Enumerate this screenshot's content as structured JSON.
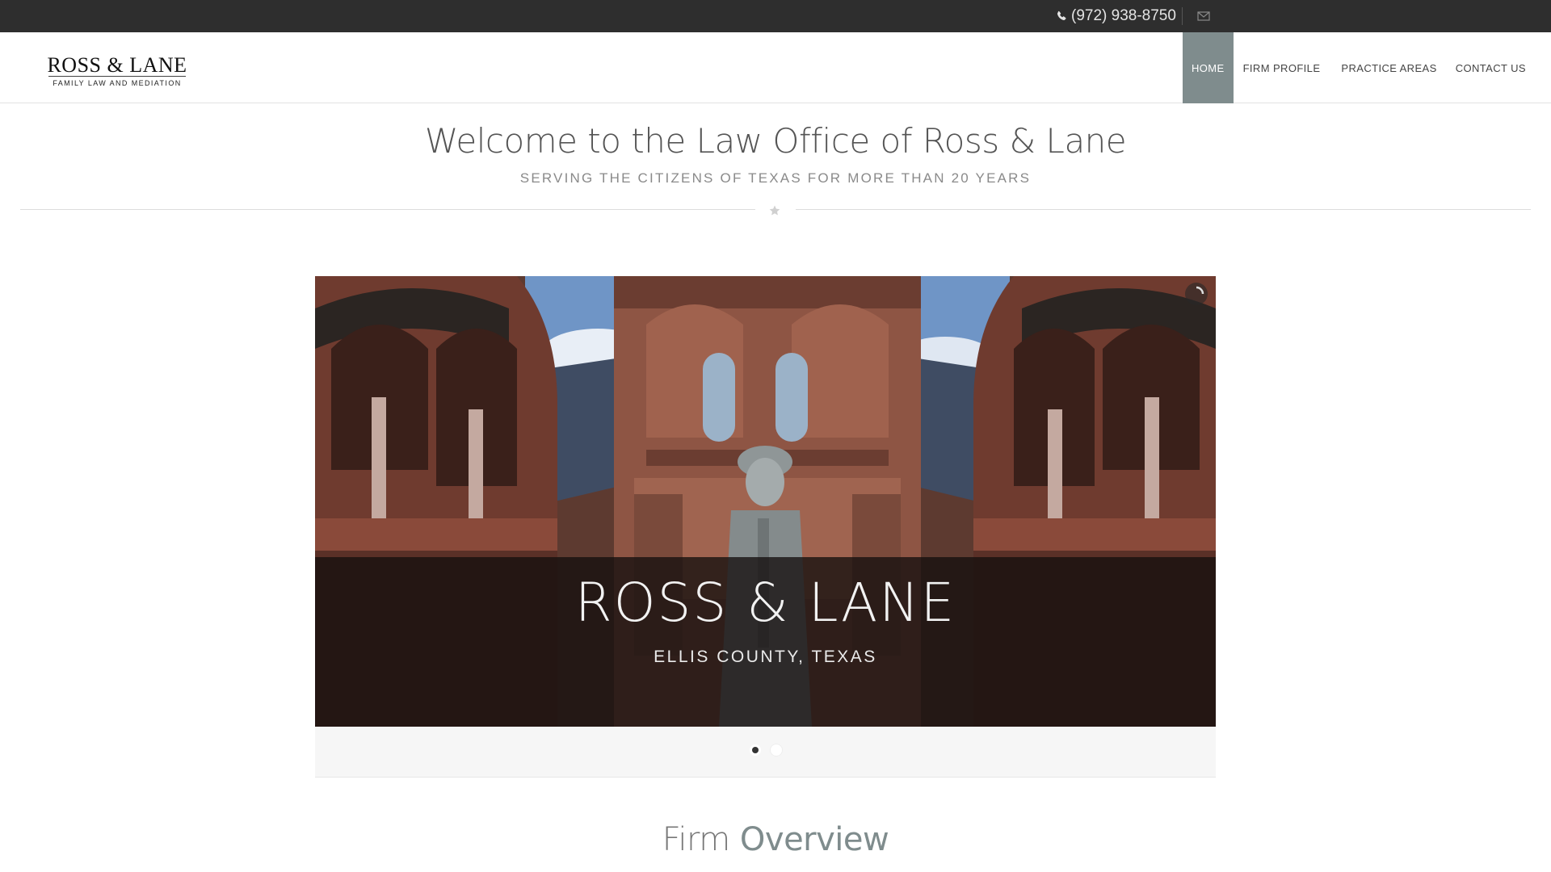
{
  "topbar": {
    "phone": "(972) 938-8750",
    "phone_icon": "phone-icon",
    "email_icon": "envelope-icon"
  },
  "header": {
    "logo": {
      "name": "ROSS & LANE",
      "tagline": "FAMILY LAW AND MEDIATION"
    },
    "nav": [
      {
        "label": "HOME",
        "active": true
      },
      {
        "label": "FIRM PROFILE",
        "active": false
      },
      {
        "label": "PRACTICE AREAS",
        "active": false
      },
      {
        "label": "CONTACT US",
        "active": false
      }
    ]
  },
  "intro": {
    "title": "Welcome to the Law Office of Ross & Lane",
    "subtitle": "SERVING THE CITIZENS OF TEXAS FOR MORE THAN 20 YEARS",
    "divider_icon": "star-icon"
  },
  "slider": {
    "title": "ROSS & LANE",
    "subtitle": "ELLIS COUNTY, TEXAS",
    "active_slide": 1,
    "slide_count": 2,
    "image_subject": "courthouse facade with statue"
  },
  "overview": {
    "light": "Firm",
    "strong": "Overview"
  },
  "colors": {
    "topbar": "#2e2e2e",
    "nav_active": "#7f8c8d",
    "accent": "#7f8c8d"
  }
}
